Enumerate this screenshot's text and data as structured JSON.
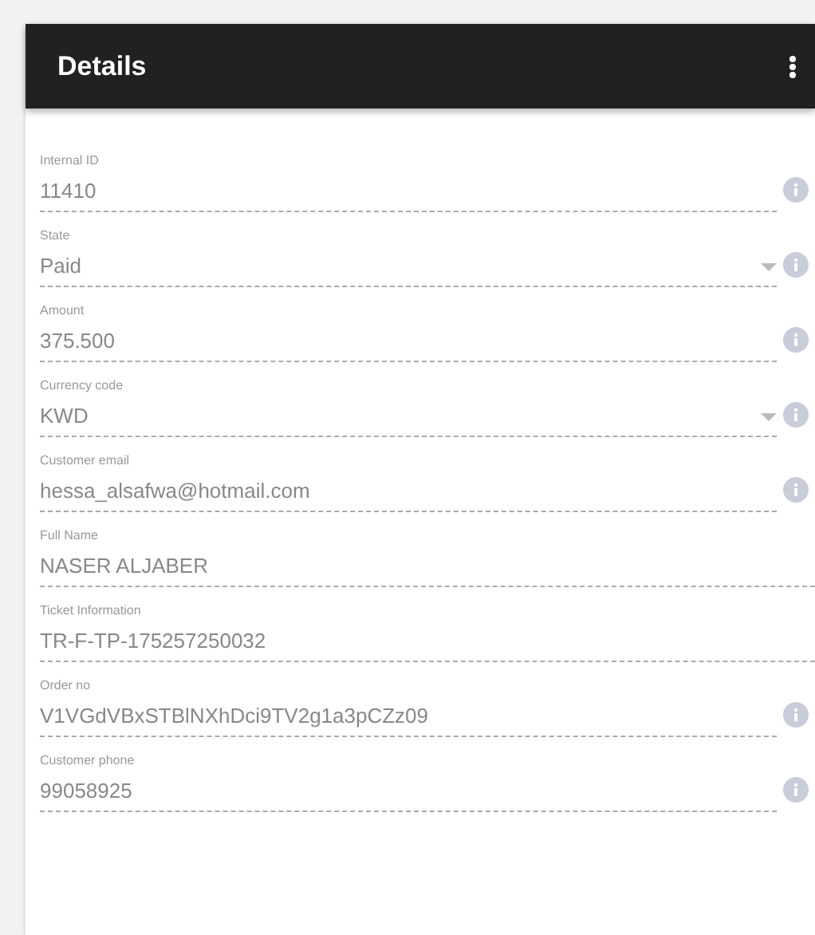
{
  "header": {
    "title": "Details"
  },
  "fields": [
    {
      "label": "Internal ID",
      "value": "11410",
      "kind": "text",
      "info": true
    },
    {
      "label": "State",
      "value": "Paid",
      "kind": "select",
      "info": true
    },
    {
      "label": "Amount",
      "value": "375.500",
      "kind": "text",
      "info": true
    },
    {
      "label": "Currency code",
      "value": "KWD",
      "kind": "select",
      "info": true
    },
    {
      "label": "Customer email",
      "value": "hessa_alsafwa@hotmail.com",
      "kind": "text",
      "info": true
    },
    {
      "label": "Full Name",
      "value": "NASER ALJABER",
      "kind": "text",
      "info": false
    },
    {
      "label": "Ticket Information",
      "value": "TR-F-TP-175257250032",
      "kind": "text",
      "info": false
    },
    {
      "label": "Order no",
      "value": "V1VGdVBxSTBlNXhDci9TV2g1a3pCZz09",
      "kind": "text",
      "info": true
    },
    {
      "label": "Customer phone",
      "value": "99058925",
      "kind": "text",
      "info": true
    }
  ]
}
